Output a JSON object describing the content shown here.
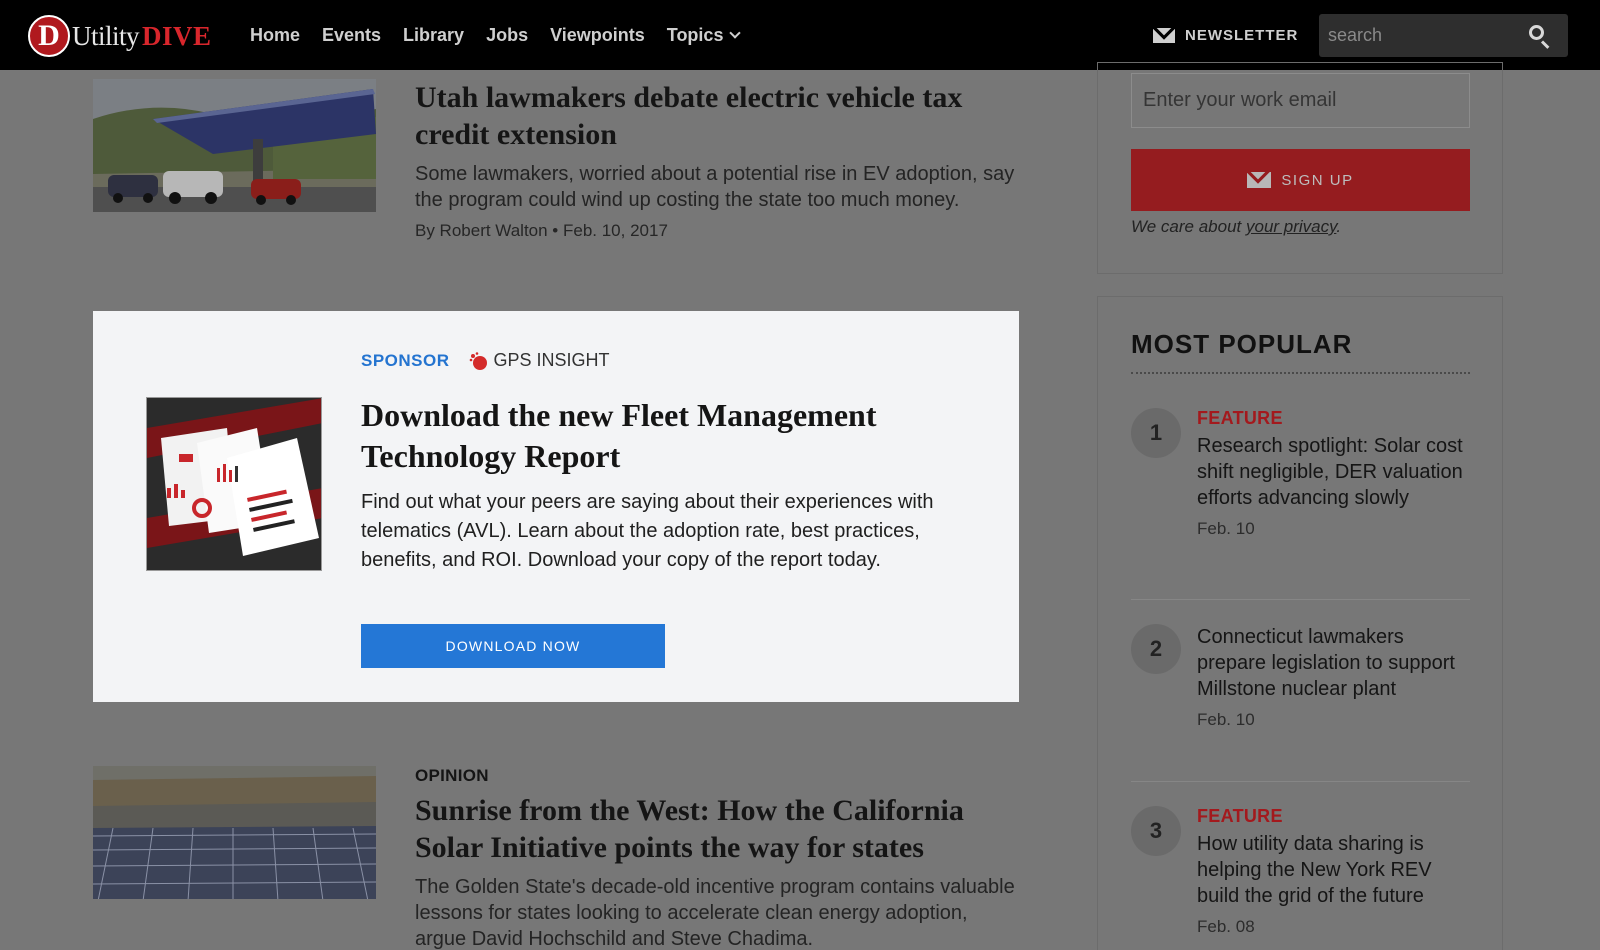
{
  "brand": {
    "logo_letter": "D",
    "logo_word1": "Utility",
    "logo_word2": "DIVE"
  },
  "nav": {
    "links": [
      "Home",
      "Events",
      "Library",
      "Jobs",
      "Viewpoints",
      "Topics"
    ],
    "newsletter_label": "NEWSLETTER",
    "search_placeholder": "search"
  },
  "articles": [
    {
      "kicker": "",
      "title": "Utah lawmakers debate electric vehicle tax credit extension",
      "description": "Some lawmakers, worried about a potential rise in EV adoption, say the program could wind up costing the state too much money.",
      "byline": "By Robert Walton • Feb. 10, 2017"
    },
    {
      "kicker": "OPINION",
      "title": "Sunrise from the West: How the California Solar Initiative points the way for states",
      "description": "The Golden State's decade-old incentive program contains valuable lessons for states looking to accelerate clean energy adoption, argue David Hochschild and Steve Chadima.",
      "byline": ""
    }
  ],
  "sponsor": {
    "label": "SPONSOR",
    "company": "GPS INSIGHT",
    "title": "Download the new Fleet Management Technology Report",
    "description": "Find out what your peers are saying about their experiences with telematics (AVL). Learn about the adoption rate, best practices, benefits, and ROI. Download your copy of the report today.",
    "button_label": "DOWNLOAD NOW"
  },
  "signup": {
    "email_placeholder": "Enter your work email",
    "button_label": "SIGN UP",
    "privacy_prefix": "We care about ",
    "privacy_link": "your privacy",
    "privacy_suffix": "."
  },
  "most_popular": {
    "heading": "MOST POPULAR",
    "items": [
      {
        "rank": "1",
        "tag": "FEATURE",
        "title": "Research spotlight: Solar cost shift negligible, DER valuation efforts advancing slowly",
        "date": "Feb. 10"
      },
      {
        "rank": "2",
        "tag": "",
        "title": "Connecticut lawmakers prepare legislation to support Millstone nuclear plant",
        "date": "Feb. 10"
      },
      {
        "rank": "3",
        "tag": "FEATURE",
        "title": "How utility data sharing is helping the New York REV build the grid of the future",
        "date": "Feb. 08"
      }
    ]
  },
  "colors": {
    "accent_red": "#a3191d",
    "sponsor_blue": "#2474d0",
    "overlay_gray": "#777777"
  }
}
